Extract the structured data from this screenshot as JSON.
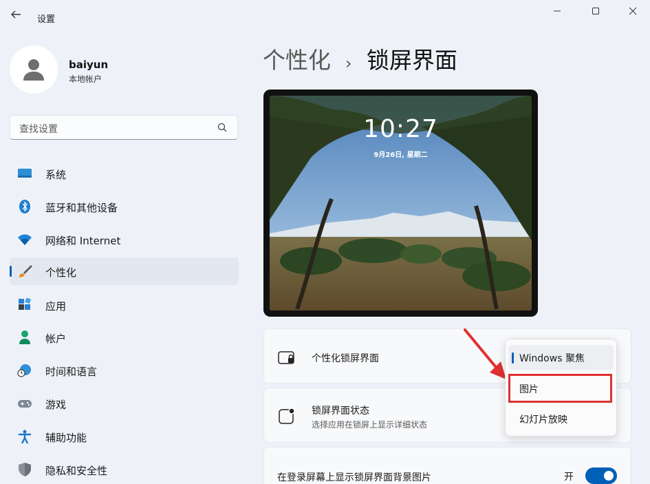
{
  "window": {
    "title": "设置"
  },
  "account": {
    "name": "baiyun",
    "type": "本地帐户"
  },
  "search": {
    "placeholder": "查找设置"
  },
  "nav": [
    {
      "label": "系统",
      "icon": "monitor-icon"
    },
    {
      "label": "蓝牙和其他设备",
      "icon": "bluetooth-icon"
    },
    {
      "label": "网络和 Internet",
      "icon": "wifi-icon"
    },
    {
      "label": "个性化",
      "icon": "brush-icon",
      "active": true
    },
    {
      "label": "应用",
      "icon": "apps-icon"
    },
    {
      "label": "帐户",
      "icon": "person-icon"
    },
    {
      "label": "时间和语言",
      "icon": "globe-clock-icon"
    },
    {
      "label": "游戏",
      "icon": "gamepad-icon"
    },
    {
      "label": "辅助功能",
      "icon": "accessibility-icon"
    },
    {
      "label": "隐私和安全性",
      "icon": "shield-icon"
    }
  ],
  "breadcrumb": {
    "parent": "个性化",
    "separator": "›",
    "current": "锁屏界面"
  },
  "preview": {
    "time": "10:27",
    "date": "9月26日, 星期二"
  },
  "settings": {
    "personalize": {
      "title": "个性化锁屏界面"
    },
    "status": {
      "title": "锁屏界面状态",
      "subtitle": "选择应用在锁屏上显示详细状态"
    },
    "background": {
      "title": "在登录屏幕上显示锁屏界面背景图片",
      "toggle_label": "开",
      "toggle_on": true
    }
  },
  "dropdown": {
    "options": [
      "Windows 聚焦",
      "图片",
      "幻灯片放映"
    ],
    "selected": "Windows 聚焦",
    "highlighted": "图片"
  },
  "colors": {
    "accent": "#005fb8",
    "highlight": "#e03030"
  }
}
